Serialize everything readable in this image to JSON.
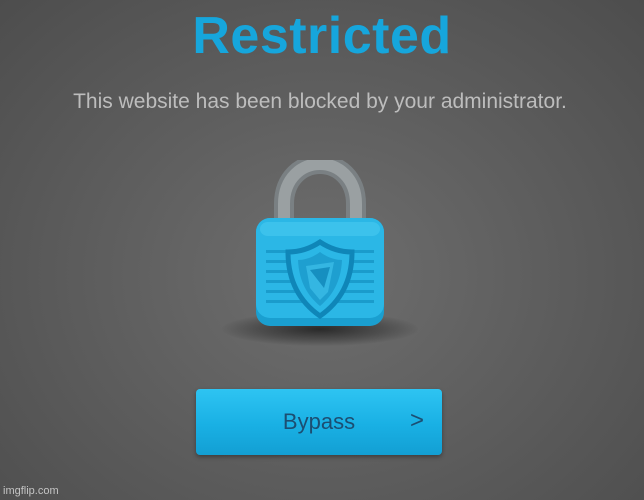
{
  "page": {
    "title": "Restricted",
    "message": "This website has been blocked by your administrator."
  },
  "lock": {
    "icon": "padlock-shield-icon",
    "shackle_color": "#8f9597",
    "body_color": "#2bb7e6",
    "shield_color": "#0f86b8"
  },
  "actions": {
    "bypass_label": "Bypass",
    "bypass_chevron": ">"
  },
  "watermark": "imgflip.com",
  "colors": {
    "accent": "#16a6dc",
    "background": "#5f5f5f",
    "button_text": "#1c4e72"
  }
}
